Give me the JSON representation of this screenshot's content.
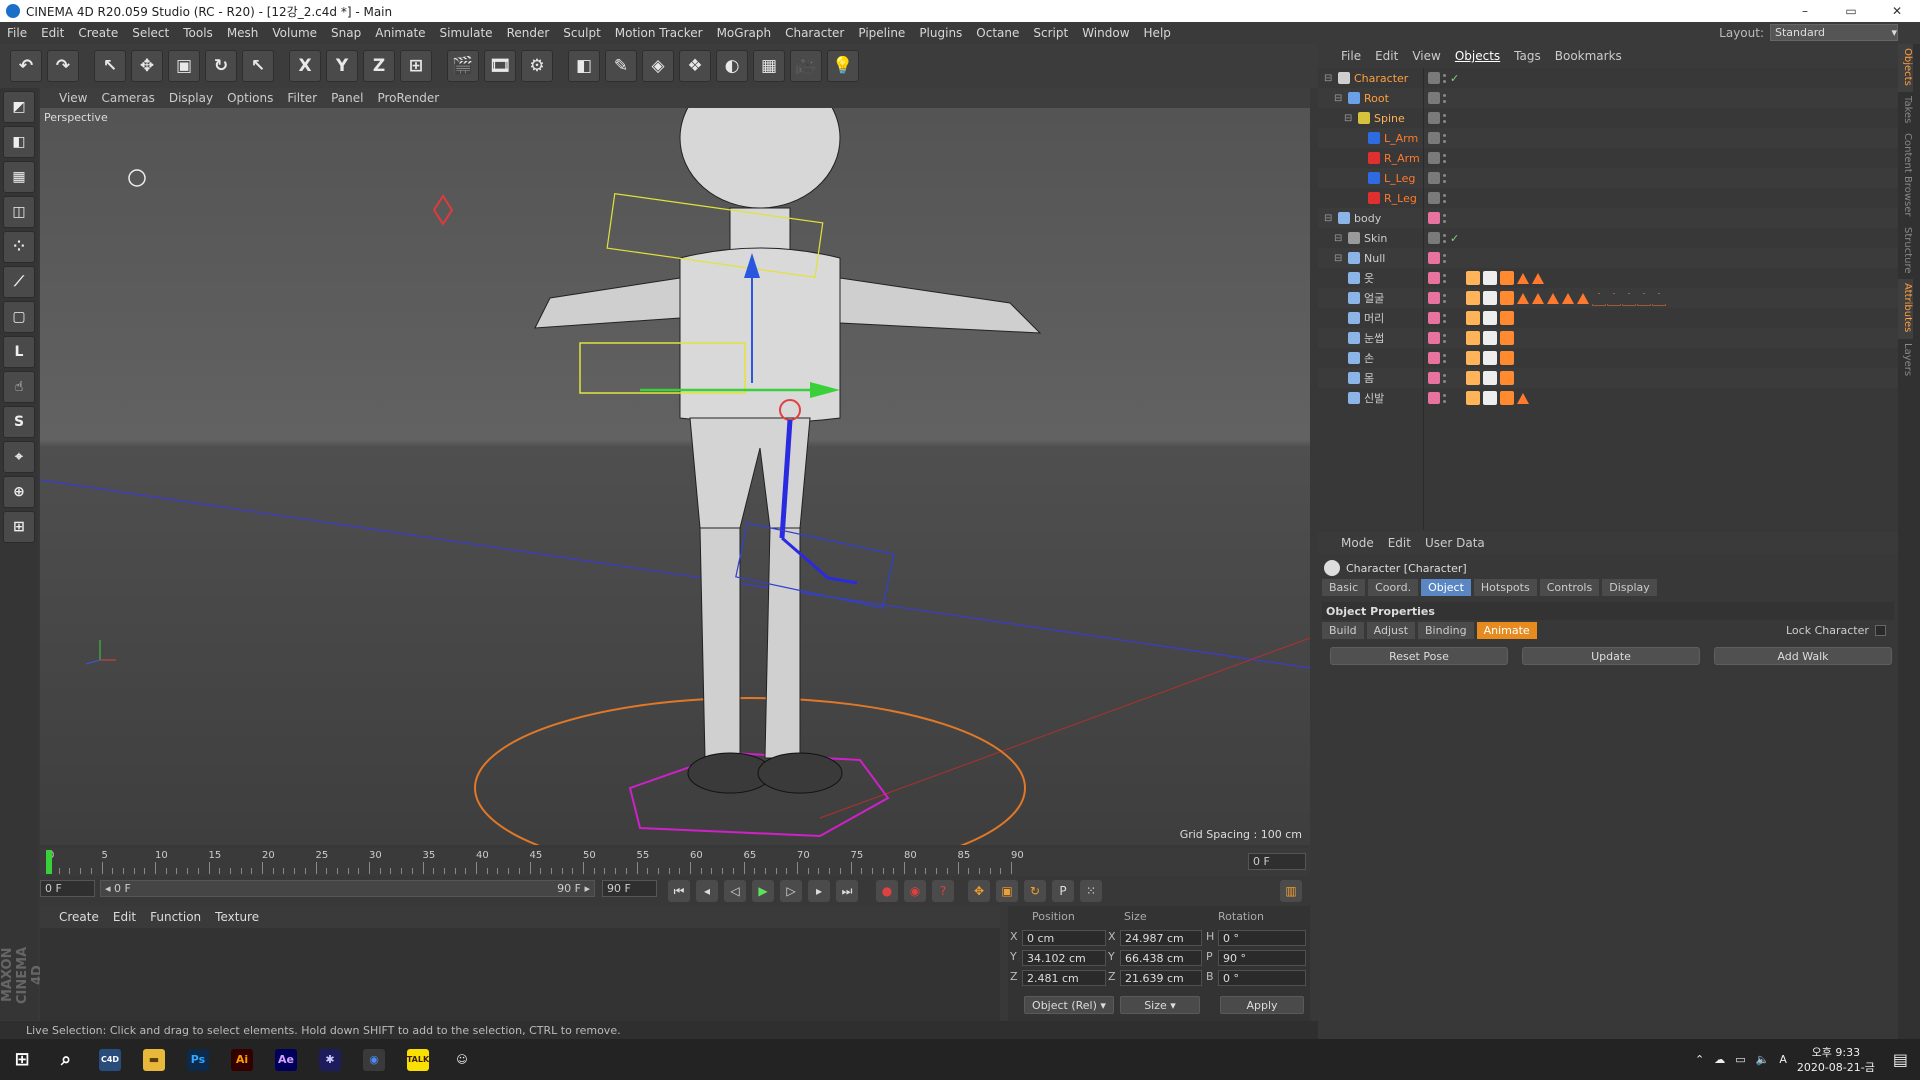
{
  "window": {
    "title": "CINEMA 4D R20.059 Studio (RC - R20) - [12강_2.c4d *] - Main",
    "minimize": "–",
    "maximize": "▭",
    "close": "✕"
  },
  "menubar": [
    "File",
    "Edit",
    "Create",
    "Select",
    "Tools",
    "Mesh",
    "Volume",
    "Snap",
    "Animate",
    "Simulate",
    "Render",
    "Sculpt",
    "Motion Tracker",
    "MoGraph",
    "Character",
    "Pipeline",
    "Plugins",
    "Octane",
    "Script",
    "Window",
    "Help"
  ],
  "layout": {
    "label": "Layout:",
    "value": "Standard"
  },
  "toolbar": [
    {
      "name": "undo-icon",
      "glyph": "↶"
    },
    {
      "name": "redo-icon",
      "glyph": "↷"
    },
    {
      "name": "live-selection-icon",
      "glyph": "↖"
    },
    {
      "name": "move-icon",
      "glyph": "✥"
    },
    {
      "name": "scale-icon",
      "glyph": "▣"
    },
    {
      "name": "rotate-icon",
      "glyph": "↻"
    },
    {
      "name": "recent-tool-icon",
      "glyph": "↖"
    },
    {
      "name": "x-axis-icon",
      "glyph": "X"
    },
    {
      "name": "y-axis-icon",
      "glyph": "Y"
    },
    {
      "name": "z-axis-icon",
      "glyph": "Z"
    },
    {
      "name": "coordinate-system-icon",
      "glyph": "⊞"
    },
    {
      "name": "render-view-icon",
      "glyph": "🎬"
    },
    {
      "name": "render-picture-viewer-icon",
      "glyph": "🎞"
    },
    {
      "name": "render-settings-icon",
      "glyph": "⚙"
    },
    {
      "name": "cube-icon",
      "glyph": "◧"
    },
    {
      "name": "pen-spline-icon",
      "glyph": "✎"
    },
    {
      "name": "subdivision-icon",
      "glyph": "◈"
    },
    {
      "name": "cloner-icon",
      "glyph": "❖"
    },
    {
      "name": "deformer-icon",
      "glyph": "◐"
    },
    {
      "name": "floor-icon",
      "glyph": "▦"
    },
    {
      "name": "camera-icon",
      "glyph": "🎥"
    },
    {
      "name": "light-icon",
      "glyph": "💡"
    }
  ],
  "lefttools": [
    "make-editable-icon",
    "model-mode-icon",
    "texture-mode-icon",
    "workplane-icon",
    "points-mode-icon",
    "edges-mode-icon",
    "polygons-mode-icon",
    "axis-icon",
    "tweak-icon",
    "solo-icon",
    "snap-icon",
    "enable-snap-icon",
    "locked-workplane-icon"
  ],
  "maxon": "MAXON CINEMA 4D",
  "viewport": {
    "menu": [
      "View",
      "Cameras",
      "Display",
      "Options",
      "Filter",
      "Panel",
      "ProRender"
    ],
    "label": "Perspective",
    "grid_spacing": "Grid Spacing : 100 cm"
  },
  "timeline": {
    "ticks": [
      "0",
      "5",
      "10",
      "15",
      "20",
      "25",
      "30",
      "35",
      "40",
      "45",
      "50",
      "55",
      "60",
      "65",
      "70",
      "75",
      "80",
      "85",
      "90"
    ],
    "current_frame": "0 F",
    "start_field": "0 F",
    "range_start": "◂ 0 F",
    "range_end": "90 F ▸",
    "end_field": "90 F"
  },
  "material_menu": [
    "Create",
    "Edit",
    "Function",
    "Texture"
  ],
  "coords": {
    "headers": [
      "Position",
      "Size",
      "Rotation"
    ],
    "rows": [
      {
        "axis": "X",
        "pos": "0 cm",
        "sz_axis": "X",
        "size": "24.987 cm",
        "rot_axis": "H",
        "rot": "0 °"
      },
      {
        "axis": "Y",
        "pos": "34.102 cm",
        "sz_axis": "Y",
        "size": "66.438 cm",
        "rot_axis": "P",
        "rot": "90 °"
      },
      {
        "axis": "Z",
        "pos": "2.481 cm",
        "sz_axis": "Z",
        "size": "21.639 cm",
        "rot_axis": "B",
        "rot": "0 °"
      }
    ],
    "mode": "Object (Rel)",
    "size_mode": "Size",
    "apply": "Apply"
  },
  "status": "Live Selection: Click and drag to select elements. Hold down SHIFT to add to the selection, CTRL to remove.",
  "objects_menu": [
    "File",
    "Edit",
    "View",
    "Objects",
    "Tags",
    "Bookmarks"
  ],
  "objects": [
    {
      "name": "Character",
      "indent": 0,
      "color": "#ff9f3e",
      "icon": "#cfcfcf",
      "vis": "grey",
      "check": true,
      "tags": []
    },
    {
      "name": "Root",
      "indent": 1,
      "color": "#ff9f3e",
      "icon": "#6aa0e8",
      "vis": "grey",
      "check": false,
      "tags": []
    },
    {
      "name": "Spine",
      "indent": 2,
      "color": "#ffb15a",
      "icon": "#d6c23c",
      "vis": "grey",
      "check": false,
      "tags": []
    },
    {
      "name": "L_Arm",
      "indent": 3,
      "color": "#ff7a2e",
      "icon": "#2f6be0",
      "vis": "grey",
      "check": false,
      "tags": []
    },
    {
      "name": "R_Arm",
      "indent": 3,
      "color": "#ff7a2e",
      "icon": "#e02f2f",
      "vis": "grey",
      "check": false,
      "tags": []
    },
    {
      "name": "L_Leg",
      "indent": 3,
      "color": "#ff7a2e",
      "icon": "#2f6be0",
      "vis": "grey",
      "check": false,
      "tags": []
    },
    {
      "name": "R_Leg",
      "indent": 3,
      "color": "#ff7a2e",
      "icon": "#e02f2f",
      "vis": "grey",
      "check": false,
      "tags": []
    },
    {
      "name": "body",
      "indent": 0,
      "color": "#cccccc",
      "icon": "#8cb4e6",
      "vis": "pink",
      "check": false,
      "tags": []
    },
    {
      "name": "Skin",
      "indent": 1,
      "color": "#cccccc",
      "icon": "#9a9a9a",
      "vis": "grey",
      "check": true,
      "tags": []
    },
    {
      "name": "Null",
      "indent": 1,
      "color": "#cccccc",
      "icon": "#8cb4e6",
      "vis": "pink",
      "check": false,
      "tags": []
    },
    {
      "name": "옷",
      "indent": 1,
      "color": "#cccccc",
      "icon": "#8cb4e6",
      "vis": "pink",
      "check": false,
      "tags": [
        "tri",
        "tri"
      ]
    },
    {
      "name": "얼굴",
      "indent": 1,
      "color": "#cccccc",
      "icon": "#8cb4e6",
      "vis": "pink",
      "check": false,
      "tags": [
        "tri",
        "tri",
        "tri",
        "tri",
        "tri",
        "o",
        "o",
        "o",
        "o",
        "o"
      ]
    },
    {
      "name": "머리",
      "indent": 1,
      "color": "#cccccc",
      "icon": "#8cb4e6",
      "vis": "pink",
      "check": false,
      "tags": []
    },
    {
      "name": "눈썹",
      "indent": 1,
      "color": "#cccccc",
      "icon": "#8cb4e6",
      "vis": "pink",
      "check": false,
      "tags": []
    },
    {
      "name": "손",
      "indent": 1,
      "color": "#cccccc",
      "icon": "#8cb4e6",
      "vis": "pink",
      "check": false,
      "tags": []
    },
    {
      "name": "몸",
      "indent": 1,
      "color": "#cccccc",
      "icon": "#8cb4e6",
      "vis": "pink",
      "check": false,
      "tags": []
    },
    {
      "name": "신발",
      "indent": 1,
      "color": "#cccccc",
      "icon": "#8cb4e6",
      "vis": "pink",
      "check": false,
      "tags": [
        "tri"
      ]
    }
  ],
  "attr_menu": [
    "Mode",
    "Edit",
    "User Data"
  ],
  "attributes": {
    "title": "Character [Character]",
    "tabs": [
      "Basic",
      "Coord.",
      "Object",
      "Hotspots",
      "Controls",
      "Display"
    ],
    "section": "Object Properties",
    "subtabs": [
      "Build",
      "Adjust",
      "Binding",
      "Animate"
    ],
    "lock_character": "Lock Character",
    "buttons": [
      "Reset Pose",
      "Update",
      "Add Walk"
    ]
  },
  "right_strip": [
    "Objects",
    "Takes",
    "Content Browser",
    "Structure",
    "Attributes",
    "Layers"
  ],
  "taskbar": {
    "apps": [
      {
        "name": "start-icon",
        "glyph": "⊞",
        "bg": "transparent",
        "fg": "#ffffff"
      },
      {
        "name": "search-icon",
        "glyph": "⌕",
        "bg": "transparent",
        "fg": "#ffffff"
      },
      {
        "name": "cinema4d-taskbar-icon",
        "glyph": "C4D",
        "bg": "#2a4c7a",
        "fg": "#ffffff"
      },
      {
        "name": "file-explorer-icon",
        "glyph": "▬",
        "bg": "#e8b83a",
        "fg": "#5a3e0a"
      },
      {
        "name": "photoshop-icon",
        "glyph": "Ps",
        "bg": "#0d2a4a",
        "fg": "#31a8ff"
      },
      {
        "name": "illustrator-icon",
        "glyph": "Ai",
        "bg": "#330000",
        "fg": "#ff9a00"
      },
      {
        "name": "after-effects-icon",
        "glyph": "Ae",
        "bg": "#00005b",
        "fg": "#d8a1ff"
      },
      {
        "name": "premiere-icon",
        "glyph": "✱",
        "bg": "#1d1d5b",
        "fg": "#ccccff"
      },
      {
        "name": "chrome-icon",
        "glyph": "◉",
        "bg": "#3a3a3a",
        "fg": "#4c8bf5"
      },
      {
        "name": "kakaotalk-icon",
        "glyph": "TALK",
        "bg": "#f9e000",
        "fg": "#3a1d1d"
      },
      {
        "name": "messenger-icon",
        "glyph": "☺",
        "bg": "transparent",
        "fg": "#f0f0f0"
      }
    ],
    "ime": "A",
    "time": "오후 9:33",
    "date": "2020-08-21-금"
  }
}
